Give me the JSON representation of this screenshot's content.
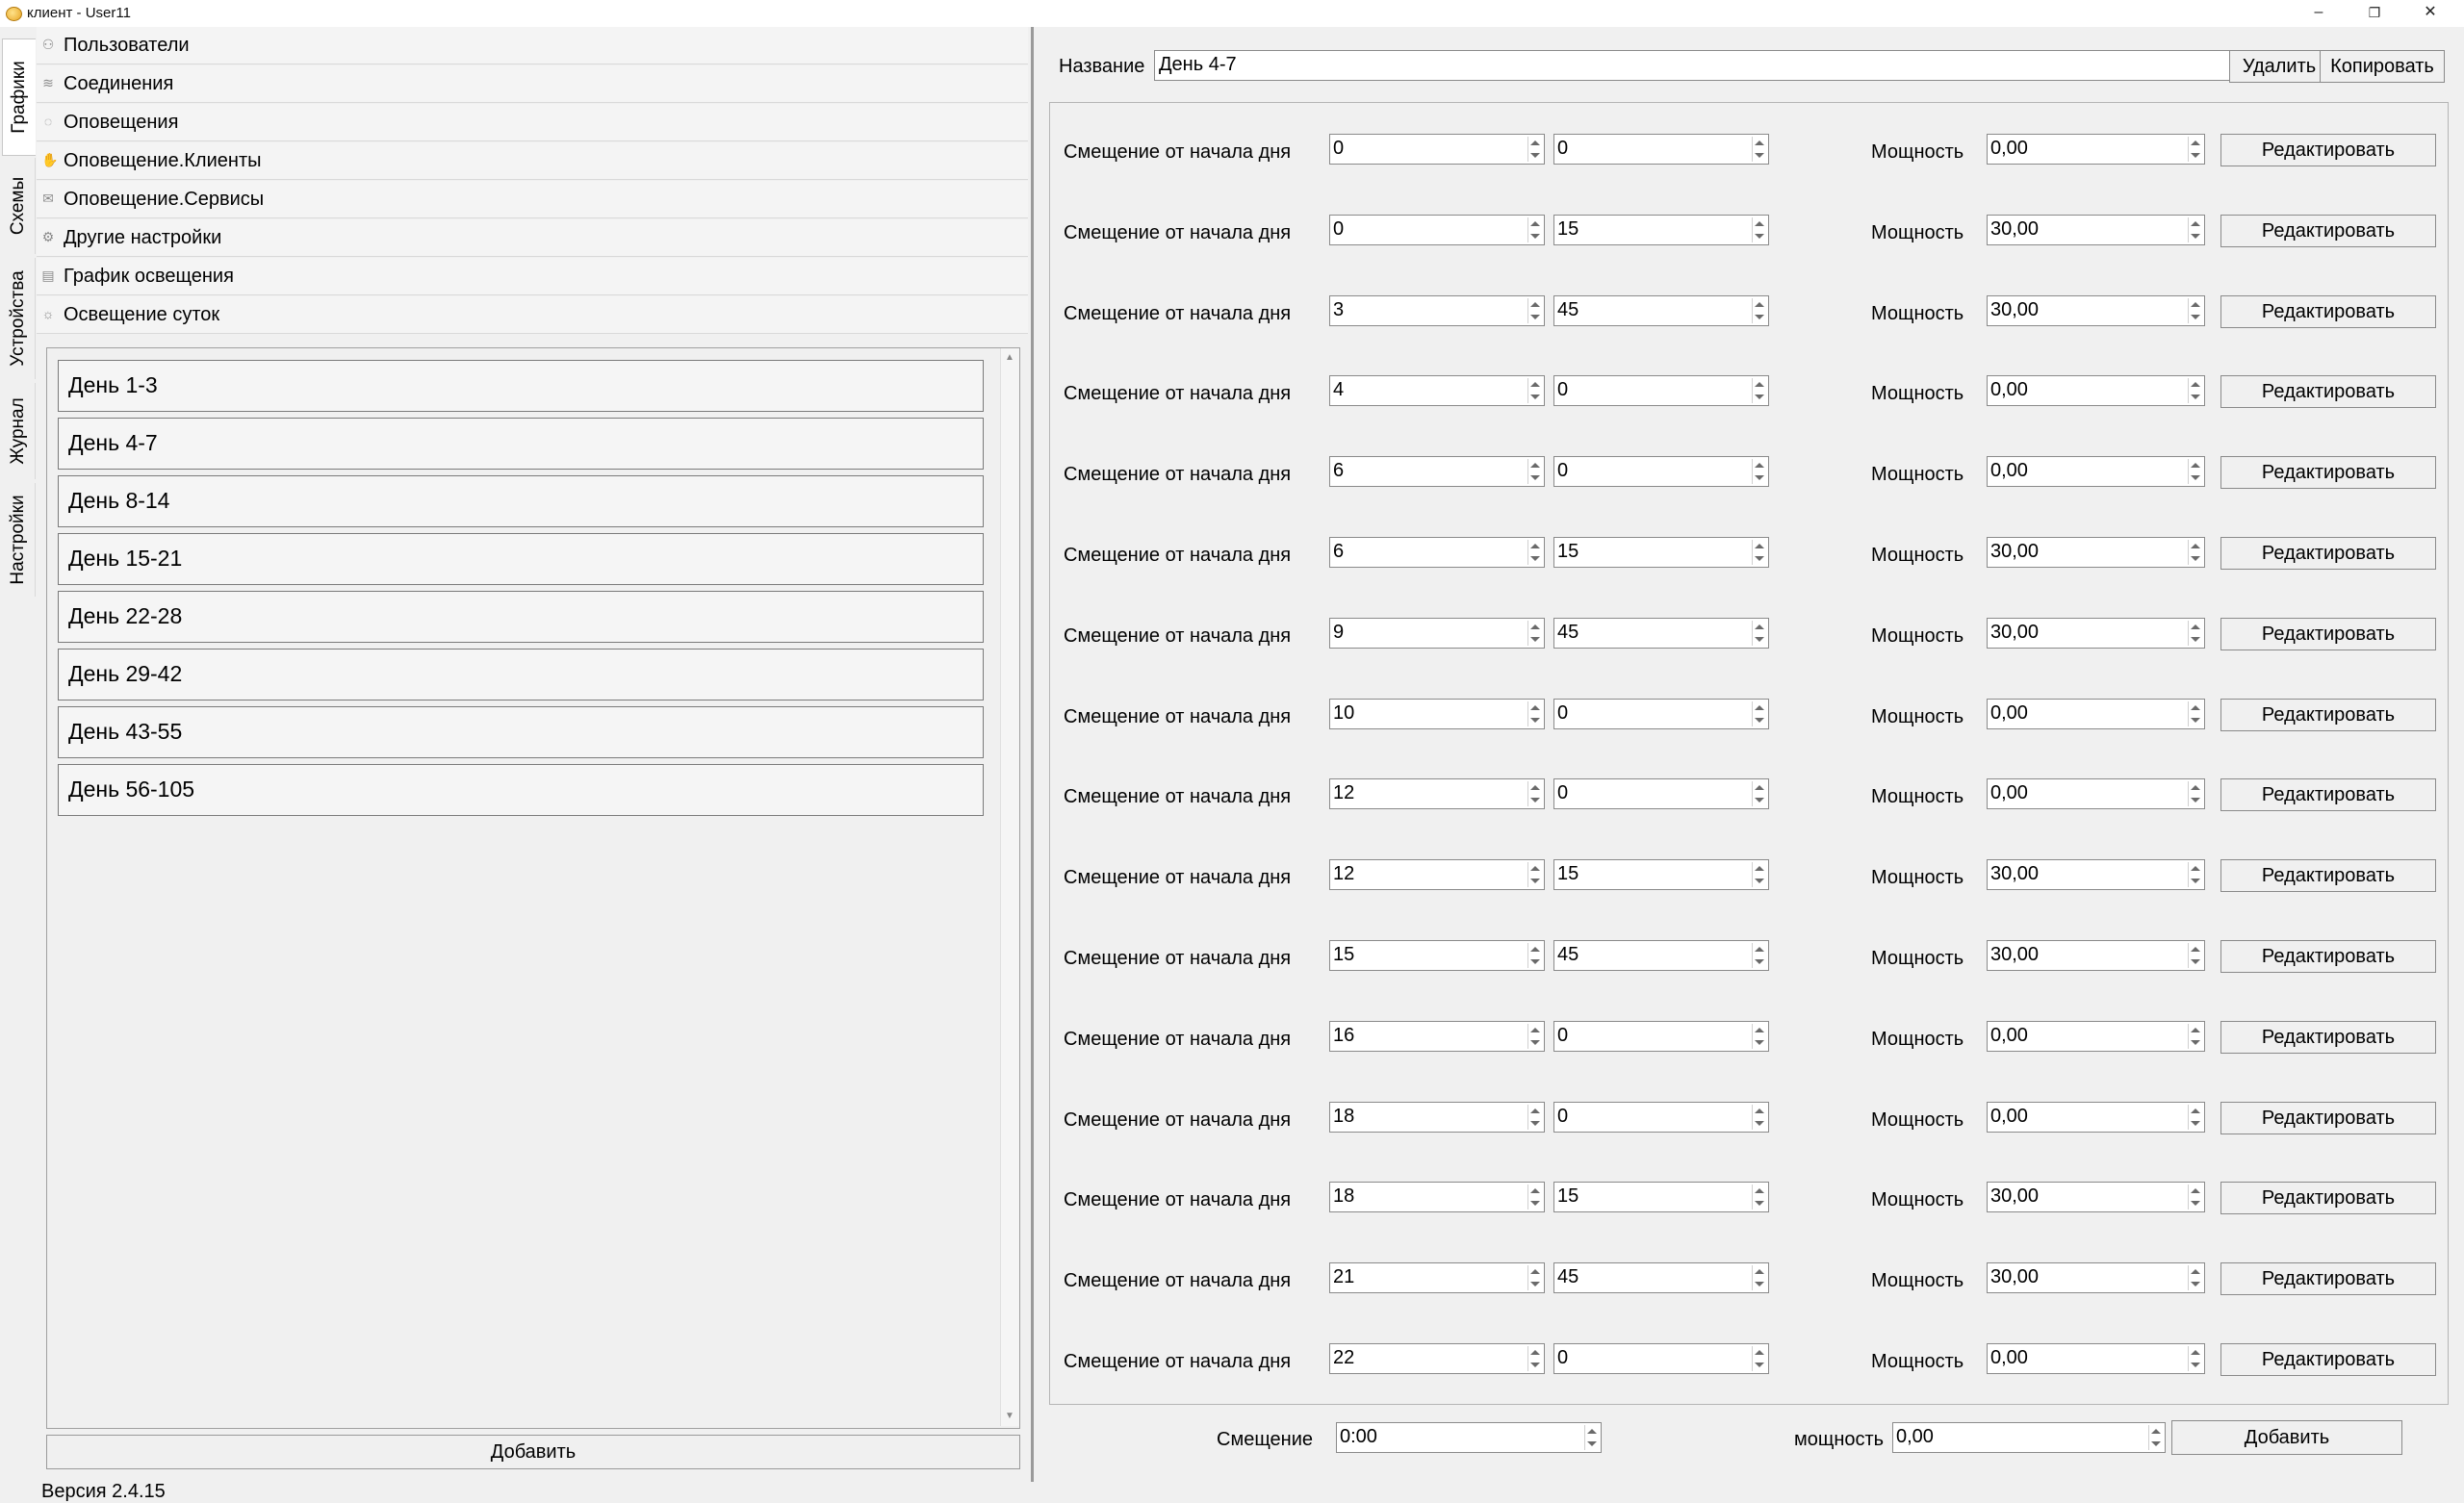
{
  "window": {
    "title": "клиент - User11",
    "controls": {
      "minimize": "–",
      "maximize": "❐",
      "close": "✕"
    }
  },
  "side_tabs": [
    "Графики",
    "Схемы",
    "Устройства",
    "Журнал",
    "Настройки"
  ],
  "nav": [
    {
      "label": "Пользователи",
      "icon": "users-icon",
      "glyph": "⚇"
    },
    {
      "label": "Соединения",
      "icon": "connections-icon",
      "glyph": "≋"
    },
    {
      "label": "Оповещения",
      "icon": "notification-icon",
      "glyph": "◌"
    },
    {
      "label": "Оповещение.Клиенты",
      "icon": "client-notification-icon",
      "glyph": "✋"
    },
    {
      "label": "Оповещение.Сервисы",
      "icon": "mail-icon",
      "glyph": "✉"
    },
    {
      "label": "Другие настройки",
      "icon": "gear-icon",
      "glyph": "⚙"
    },
    {
      "label": "График освещения",
      "icon": "lighting-schedule-icon",
      "glyph": "▤"
    },
    {
      "label": "Освещение суток",
      "icon": "daylight-icon",
      "glyph": "☼"
    }
  ],
  "days": [
    "День 1-3",
    "День 4-7",
    "День 8-14",
    "День 15-21",
    "День 22-28",
    "День 29-42",
    "День 43-55",
    "День 56-105"
  ],
  "left_add_label": "Добавить",
  "version": "Версия 2.4.15",
  "editor": {
    "name_label": "Название",
    "name_value": "День 4-7",
    "delete_label": "Удалить",
    "copy_label": "Копировать",
    "offset_label": "Смещение от начала дня",
    "power_label": "Мощность",
    "edit_label": "Редактировать",
    "entries": [
      {
        "hours": "0",
        "minutes": "0",
        "power": "0,00"
      },
      {
        "hours": "0",
        "minutes": "15",
        "power": "30,00"
      },
      {
        "hours": "3",
        "minutes": "45",
        "power": "30,00"
      },
      {
        "hours": "4",
        "minutes": "0",
        "power": "0,00"
      },
      {
        "hours": "6",
        "minutes": "0",
        "power": "0,00"
      },
      {
        "hours": "6",
        "minutes": "15",
        "power": "30,00"
      },
      {
        "hours": "9",
        "minutes": "45",
        "power": "30,00"
      },
      {
        "hours": "10",
        "minutes": "0",
        "power": "0,00"
      },
      {
        "hours": "12",
        "minutes": "0",
        "power": "0,00"
      },
      {
        "hours": "12",
        "minutes": "15",
        "power": "30,00"
      },
      {
        "hours": "15",
        "minutes": "45",
        "power": "30,00"
      },
      {
        "hours": "16",
        "minutes": "0",
        "power": "0,00"
      },
      {
        "hours": "18",
        "minutes": "0",
        "power": "0,00"
      },
      {
        "hours": "18",
        "minutes": "15",
        "power": "30,00"
      },
      {
        "hours": "21",
        "minutes": "45",
        "power": "30,00"
      },
      {
        "hours": "22",
        "minutes": "0",
        "power": "0,00"
      }
    ],
    "new_entry": {
      "offset_label": "Смещение",
      "offset_value": "0:00",
      "power_label": "мощность",
      "power_value": "0,00",
      "add_label": "Добавить"
    }
  }
}
